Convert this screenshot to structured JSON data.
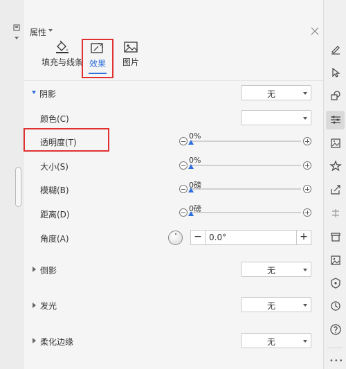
{
  "panel": {
    "title": "属性",
    "tabs": [
      {
        "label": "填充与线条",
        "icon": "fill-bucket-icon"
      },
      {
        "label": "效果",
        "icon": "effects-icon",
        "active": true
      },
      {
        "label": "图片",
        "icon": "picture-icon"
      }
    ]
  },
  "shadow": {
    "label": "阴影",
    "preset": "无",
    "color_label": "颜色(C)",
    "color_value": "",
    "transparency": {
      "label": "透明度(T)",
      "value": "0%"
    },
    "size": {
      "label": "大小(S)",
      "value": "0%"
    },
    "blur": {
      "label": "模糊(B)",
      "value": "0磅"
    },
    "distance": {
      "label": "距离(D)",
      "value": "0磅"
    },
    "angle": {
      "label": "角度(A)",
      "value": "0.0°",
      "minus": "−",
      "plus": "+"
    }
  },
  "reflection": {
    "label": "倒影",
    "value": "无"
  },
  "glow": {
    "label": "发光",
    "value": "无"
  },
  "soft_edges": {
    "label": "柔化边缘",
    "value": "无"
  },
  "right_toolbar": {
    "icons": [
      "pen-icon",
      "cursor-icon",
      "shapes-icon",
      "properties-icon",
      "image-gallery-icon",
      "star-icon",
      "share-icon",
      "split-icon",
      "archive-icon",
      "picture-icon",
      "shield-icon",
      "history-icon",
      "help-icon"
    ],
    "more": "•••"
  },
  "colors": {
    "accent": "#2f6fdc",
    "highlight": "#e03030"
  }
}
